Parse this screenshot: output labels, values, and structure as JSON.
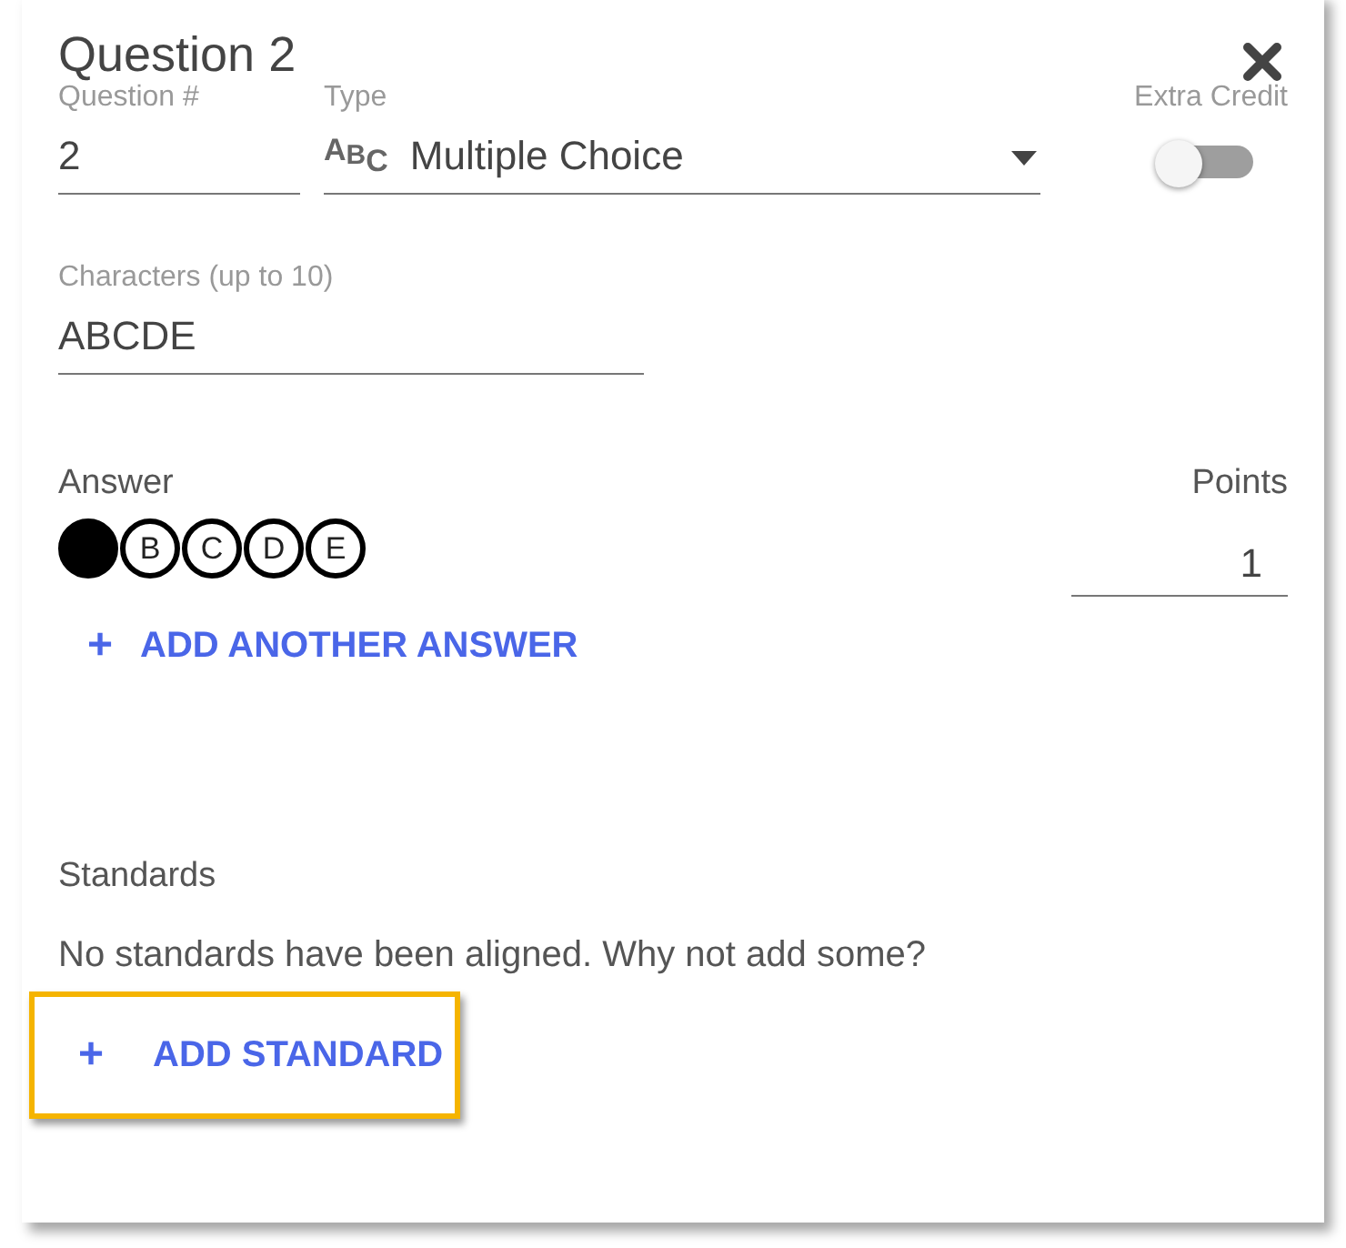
{
  "title": "Question 2",
  "question_number": {
    "label": "Question #",
    "value": "2"
  },
  "type": {
    "label": "Type",
    "icon_text": "ABC",
    "value": "Multiple Choice"
  },
  "extra_credit": {
    "label": "Extra Credit",
    "on": false
  },
  "characters": {
    "label": "Characters (up to 10)",
    "value": "ABCDE"
  },
  "answer": {
    "label": "Answer",
    "bubbles": [
      {
        "selected": true
      },
      {
        "letter": "B",
        "selected": false
      },
      {
        "letter": "C",
        "selected": false
      },
      {
        "letter": "D",
        "selected": false
      },
      {
        "letter": "E",
        "selected": false
      }
    ]
  },
  "points": {
    "label": "Points",
    "value": "1"
  },
  "add_answer": {
    "icon": "+",
    "label": "ADD ANOTHER ANSWER"
  },
  "standards": {
    "label": "Standards",
    "message": "No standards have been aligned. Why not add some?"
  },
  "add_standard": {
    "icon": "+",
    "label": "ADD STANDARD",
    "highlighted": true
  }
}
